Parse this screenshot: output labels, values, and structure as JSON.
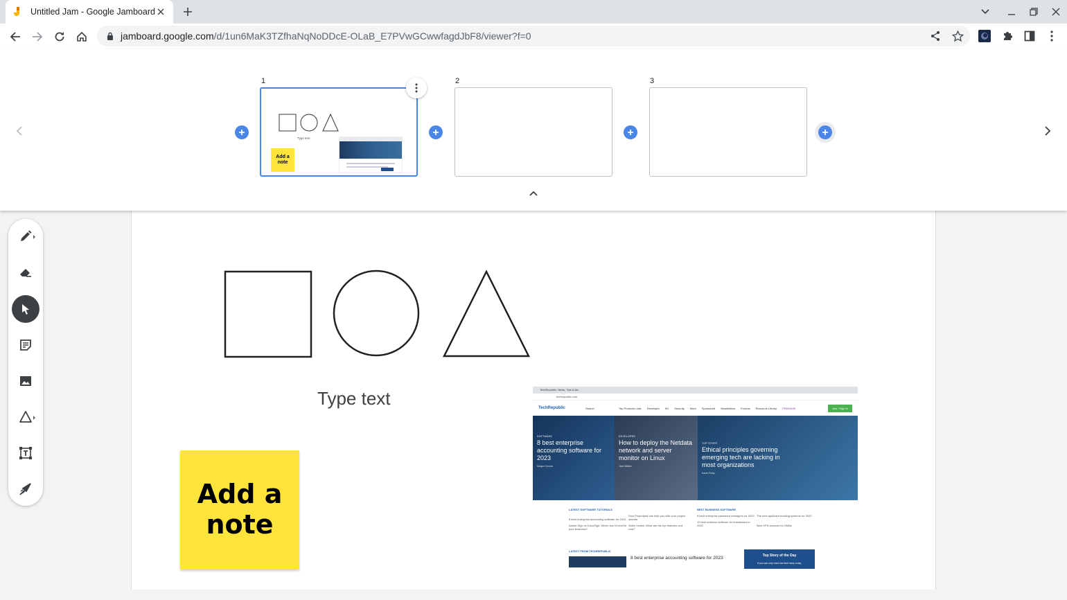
{
  "browser": {
    "tab": {
      "title": "Untitled Jam - Google Jamboard",
      "favicon": "jamboard-favicon"
    },
    "url": {
      "host": "jamboard.google.com",
      "path": "/d/1un6MaK3TZfhaNqNoDDcE-OLaB_E7PVwGCwwfagdJbF8/viewer?f=0"
    },
    "colors": {
      "tabstrip": "#dee1e6",
      "accent": "#4285f4"
    }
  },
  "framestrip": {
    "frames": [
      {
        "number": "1",
        "active": true
      },
      {
        "number": "2",
        "active": false
      },
      {
        "number": "3",
        "active": false
      }
    ],
    "thumb": {
      "text": "Type text",
      "note": "Add a note"
    }
  },
  "canvas": {
    "shapes": [
      "square",
      "circle",
      "triangle"
    ],
    "textbox": "Type text",
    "sticky_note": {
      "text": "Add a note",
      "color": "#ffe53b"
    },
    "embedded_image": {
      "tab_title": "TechRepublic: News, Tips & Ad...",
      "address": "techrepublic.com",
      "logo": "TechRepublic",
      "search": "Search",
      "nav": [
        "Top Products Lists",
        "Developer",
        "5G",
        "Security",
        "More",
        "Sponsored",
        "Newsletters",
        "Forums",
        "Resource Library"
      ],
      "premium": "PREMIUM",
      "join": "Join / Sign In",
      "hero": [
        {
          "category": "SOFTWARE",
          "headline": "8 best enterprise accounting software for 2023",
          "byline": "Megan Crouse"
        },
        {
          "category": "DEVELOPER",
          "headline": "How to deploy the Netdata network and server monitor on Linux",
          "byline": "Jack Wallen"
        },
        {
          "category": "TOP STORY",
          "headline": "Ethical principles governing emerging tech are lacking in most organizations",
          "byline": "Karen Roby"
        }
      ],
      "sections": [
        {
          "title": "LATEST SOFTWARE TUTORIALS",
          "items": [
            "8 best enterprise accounting software for 2023",
            "How Projectpad can help you with your project secrets",
            "Adobe Sign vs DocuSign: Which tool is best for your business?",
            "Wrike review: What are the top features and cost?"
          ]
        },
        {
          "title": "BEST BUSINESS SOFTWARE",
          "items": [
            "8 best enterprise password managers for 2022",
            "The best applicant tracking systems for 2022",
            "10 best antivirus software for businesses in 2022",
            "Best VPN services for SMBs"
          ]
        }
      ],
      "latest": {
        "title": "LATEST FROM TECHREPUBLIC",
        "headline": "8 best enterprise accounting software for 2023"
      },
      "top_story": {
        "title": "Top Story of the Day",
        "sub": "If you can only read one tech story a day,"
      }
    }
  },
  "tools": [
    "pen",
    "eraser",
    "select",
    "sticky-note",
    "image",
    "shape",
    "text-box",
    "laser"
  ]
}
